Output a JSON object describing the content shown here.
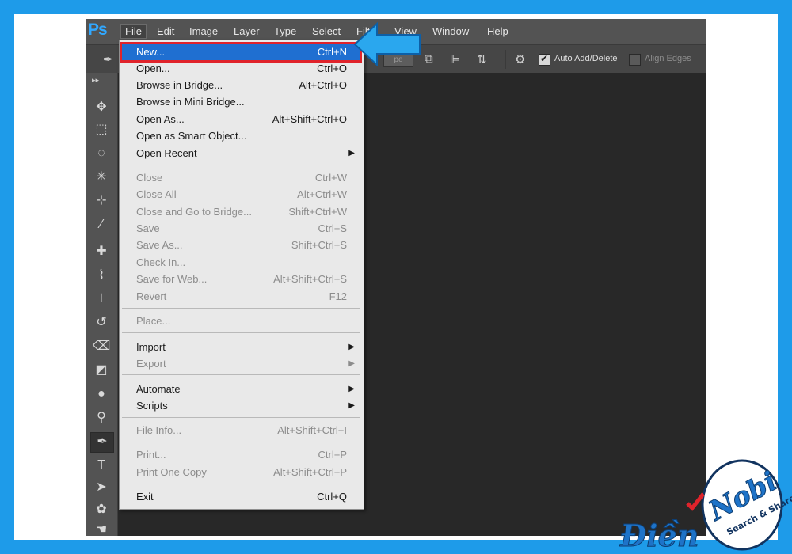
{
  "app": {
    "logo": "Ps"
  },
  "menubar": {
    "file": "File",
    "edit": "Edit",
    "image": "Image",
    "layer": "Layer",
    "type": "Type",
    "select": "Select",
    "filter": "Filt",
    "view": "View",
    "window": "Window",
    "help": "Help"
  },
  "options": {
    "shape_field": "pe",
    "auto_add_delete": "Auto Add/Delete",
    "auto_add_delete_checked": true,
    "align_edges": "Align Edges",
    "align_edges_checked": false
  },
  "file_menu": {
    "new": {
      "label": "New...",
      "shortcut": "Ctrl+N"
    },
    "open": {
      "label": "Open...",
      "shortcut": "Ctrl+O"
    },
    "browse_bridge": {
      "label": "Browse in Bridge...",
      "shortcut": "Alt+Ctrl+O"
    },
    "browse_mini_bridge": {
      "label": "Browse in Mini Bridge...",
      "shortcut": ""
    },
    "open_as": {
      "label": "Open As...",
      "shortcut": "Alt+Shift+Ctrl+O"
    },
    "open_smart": {
      "label": "Open as Smart Object...",
      "shortcut": ""
    },
    "open_recent": {
      "label": "Open Recent",
      "shortcut": ""
    },
    "close": {
      "label": "Close",
      "shortcut": "Ctrl+W"
    },
    "close_all": {
      "label": "Close All",
      "shortcut": "Alt+Ctrl+W"
    },
    "close_bridge": {
      "label": "Close and Go to Bridge...",
      "shortcut": "Shift+Ctrl+W"
    },
    "save": {
      "label": "Save",
      "shortcut": "Ctrl+S"
    },
    "save_as": {
      "label": "Save As...",
      "shortcut": "Shift+Ctrl+S"
    },
    "check_in": {
      "label": "Check In...",
      "shortcut": ""
    },
    "save_web": {
      "label": "Save for Web...",
      "shortcut": "Alt+Shift+Ctrl+S"
    },
    "revert": {
      "label": "Revert",
      "shortcut": "F12"
    },
    "place": {
      "label": "Place...",
      "shortcut": ""
    },
    "import": {
      "label": "Import",
      "shortcut": ""
    },
    "export": {
      "label": "Export",
      "shortcut": ""
    },
    "automate": {
      "label": "Automate",
      "shortcut": ""
    },
    "scripts": {
      "label": "Scripts",
      "shortcut": ""
    },
    "file_info": {
      "label": "File Info...",
      "shortcut": "Alt+Shift+Ctrl+I"
    },
    "print": {
      "label": "Print...",
      "shortcut": "Ctrl+P"
    },
    "print_one": {
      "label": "Print One Copy",
      "shortcut": "Alt+Shift+Ctrl+P"
    },
    "exit": {
      "label": "Exit",
      "shortcut": "Ctrl+Q"
    }
  },
  "watermark": {
    "script": "Điền",
    "brand": "Nobi",
    "tagline": "Search & Share"
  },
  "colors": {
    "highlight": "#1f6fd1",
    "highlight_outline": "#e0232b",
    "pointer": "#2aa7ee",
    "page_border": "#1e9be9"
  }
}
